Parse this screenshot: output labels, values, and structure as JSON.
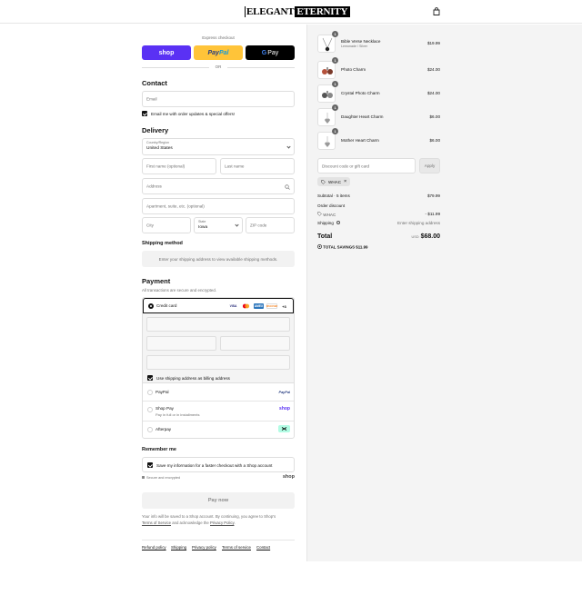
{
  "header": {
    "logo_part1": "ELEGANT",
    "logo_part2": "ETERNITY",
    "cart_icon": "shopping-bag-icon"
  },
  "express": {
    "label": "Express checkout",
    "shop_label": "shop",
    "paypal_label_1": "Pay",
    "paypal_label_2": "Pal",
    "gpay_g": "G",
    "gpay_label": "Pay",
    "or_label": "OR"
  },
  "contact": {
    "title": "Contact",
    "email_placeholder": "Email",
    "newsletter_label": "Email me with order updates & special offers!",
    "newsletter_checked": true
  },
  "delivery": {
    "title": "Delivery",
    "country_label": "Country/Region",
    "country_value": "United States",
    "first_name_placeholder": "First name (optional)",
    "last_name_placeholder": "Last name",
    "address_placeholder": "Address",
    "apartment_placeholder": "Apartment, suite, etc. (optional)",
    "city_placeholder": "City",
    "state_label": "State",
    "state_value": "Iowa",
    "zip_placeholder": "ZIP code"
  },
  "shipping_method": {
    "title": "Shipping method",
    "message": "Enter your shipping address to view available shipping methods."
  },
  "payment": {
    "title": "Payment",
    "subtitle": "All transactions are secure and encrypted.",
    "credit_card_label": "Credit card",
    "card_brands": [
      "VISA",
      "MC",
      "AMEX",
      "DISCOVER"
    ],
    "more_brands": "+3",
    "billing_same_label": "Use shipping address as billing address",
    "billing_same_checked": true,
    "options": [
      {
        "label": "PayPal",
        "sub": "",
        "badge": "PayPal"
      },
      {
        "label": "Shop Pay",
        "sub": "Pay in full or in installments",
        "badge": "shop"
      },
      {
        "label": "Afterpay",
        "sub": "",
        "badge": "afterpay-icon"
      }
    ]
  },
  "remember": {
    "title": "Remember me",
    "save_label": "Save my information for a faster checkout with a Shop account",
    "save_checked": true,
    "secure_label": "Secure and encrypted",
    "shop_logo": "shop"
  },
  "pay_now_label": "Pay now",
  "legal": {
    "line1": "Your info will be saved to a Shop account. By continuing, you agree to Shop's",
    "terms_link": "Terms of Service",
    "mid": " and acknowledge the ",
    "privacy_link": "Privacy Policy",
    "end": "."
  },
  "footer_links": [
    "Refund policy",
    "Shipping",
    "Privacy policy",
    "Terms of service",
    "Contact"
  ],
  "cart": {
    "items": [
      {
        "qty": "1",
        "name": "Bible Verse Necklace",
        "variant": "Lemonade / Silver",
        "price": "$19.99"
      },
      {
        "qty": "1",
        "name": "Photo Charm",
        "variant": "",
        "price": "$24.00"
      },
      {
        "qty": "1",
        "name": "Crystal Photo Charm",
        "variant": "",
        "price": "$24.00"
      },
      {
        "qty": "1",
        "name": "Daughter Heart Charm",
        "variant": "",
        "price": "$6.00"
      },
      {
        "qty": "1",
        "name": "Mother Heart Charm",
        "variant": "",
        "price": "$6.00"
      }
    ],
    "discount_placeholder": "Discount code or gift card",
    "apply_label": "Apply",
    "applied_code": "WHAC",
    "subtotal_label": "Subtotal · 5 items",
    "subtotal_value": "$79.99",
    "order_discount_label": "Order discount",
    "discount_code": "WHAC",
    "discount_value": "- $11.99",
    "shipping_label": "Shipping",
    "shipping_value": "Enter shipping address",
    "total_label": "Total",
    "currency": "USD",
    "total_value": "$68.00",
    "savings_label": "TOTAL SAVINGS",
    "savings_value": "$11.99"
  },
  "colors": {
    "shop_purple": "#5a31f4",
    "paypal_yellow": "#ffc439",
    "summary_bg": "#f4f4f4"
  }
}
